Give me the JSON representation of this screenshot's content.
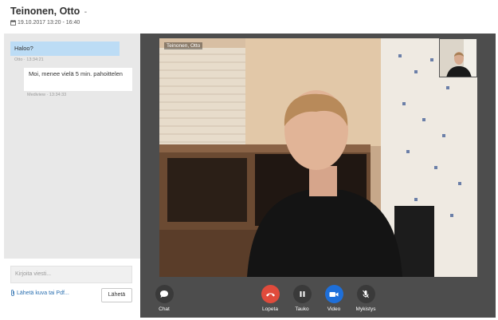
{
  "header": {
    "title": "Teinonen, Otto",
    "title_suffix": "-",
    "date_range": "19.10.2017 13:20 - 16:40"
  },
  "chat": {
    "messages": [
      {
        "text": "Haloo?",
        "meta": "Otto · 13:34:21",
        "direction": "incoming"
      },
      {
        "text": "Moi, menee vielä 5 min. pahoittelen",
        "meta": "Mediview · 13:34:33",
        "direction": "outgoing"
      }
    ],
    "compose_placeholder": "Kirjoita viesti...",
    "attach_label": "Lähetä kuva tai Pdf...",
    "send_label": "Lähetä"
  },
  "video": {
    "remote_name": "Teinonen, Otto"
  },
  "controls": [
    {
      "label": "Chat",
      "icon": "chat-bubble-icon",
      "color": "#3a3a3a"
    },
    {
      "label": "Lopeta",
      "icon": "hang-up-icon",
      "color": "#e04b3c"
    },
    {
      "label": "Tauko",
      "icon": "pause-icon",
      "color": "#3a3a3a"
    },
    {
      "label": "Video",
      "icon": "camera-icon",
      "color": "#1e6fd9"
    },
    {
      "label": "Mykistys",
      "icon": "microphone-muted-icon",
      "color": "#3a3a3a"
    }
  ],
  "colors": {
    "incoming_bubble": "#bcdcf5",
    "stage_background": "#4d4d4d",
    "link": "#2a6fb0"
  }
}
